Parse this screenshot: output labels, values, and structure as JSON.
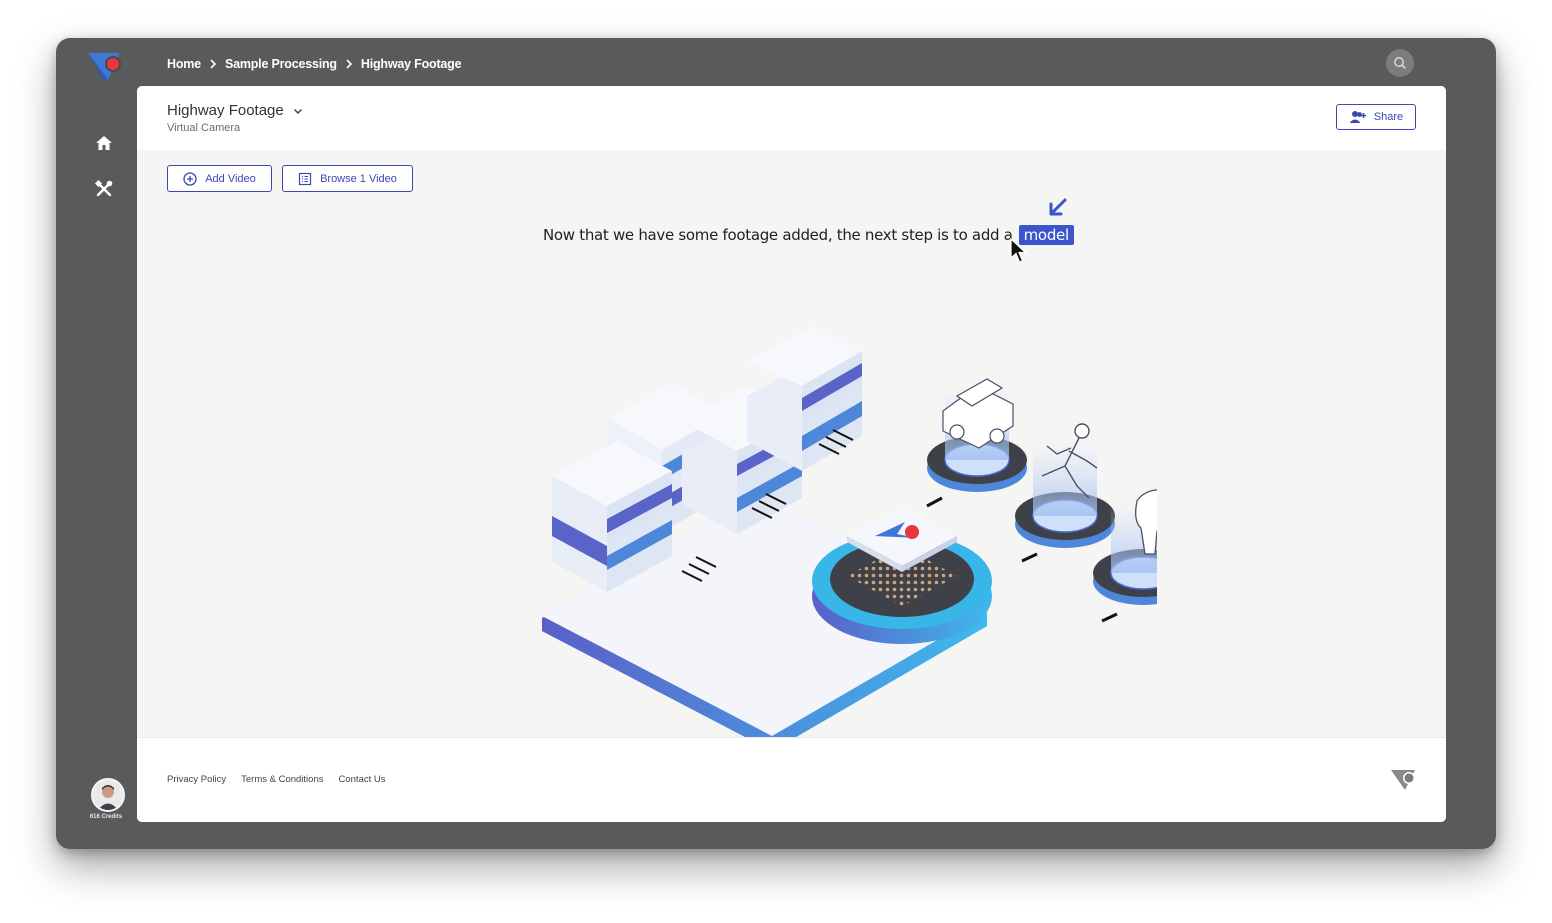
{
  "breadcrumb": {
    "items": [
      "Home",
      "Sample Processing",
      "Highway Footage"
    ]
  },
  "sidebar": {
    "items": [
      {
        "name": "home",
        "icon": "home-icon"
      },
      {
        "name": "tools",
        "icon": "tools-icon"
      }
    ],
    "credits": "616 Credits"
  },
  "header": {
    "title": "Highway Footage",
    "subtitle": "Virtual Camera",
    "share_label": "Share"
  },
  "toolbar": {
    "add_video_label": "Add Video",
    "browse_label": "Browse 1 Video"
  },
  "onboarding": {
    "message": "Now that we have some footage added, the next step is to add a",
    "link_label": "model"
  },
  "footer": {
    "links": [
      "Privacy Policy",
      "Terms & Conditions",
      "Contact Us"
    ]
  },
  "colors": {
    "accent": "#3b48b0",
    "highlight": "#3d55cc",
    "brand_red": "#e8383d",
    "window_bg": "#595a5a"
  }
}
